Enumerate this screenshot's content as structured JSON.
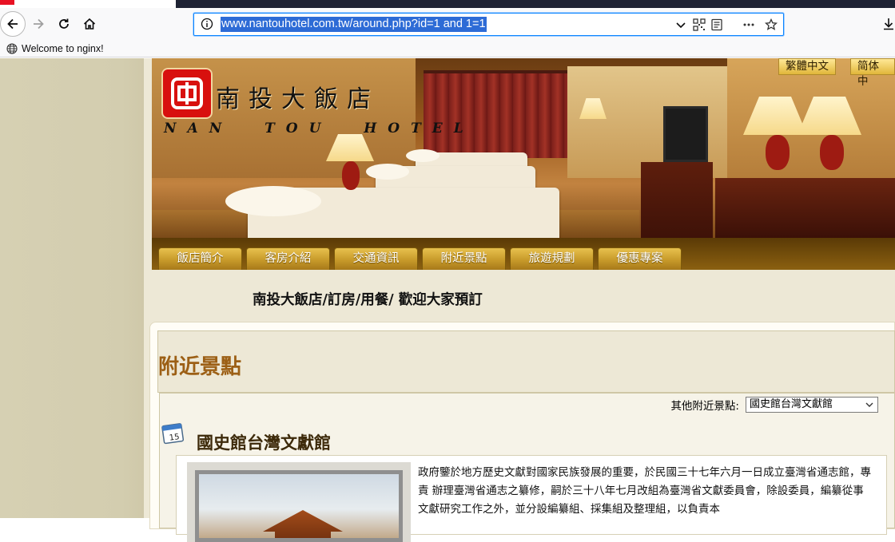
{
  "browser": {
    "url": "www.nantouhotel.com.tw/around.php?id=1 and 1=1",
    "bookmark_label": "Welcome to nginx!"
  },
  "site": {
    "logo_chinese": "南投大飯店",
    "logo_english": "NAN  TOU  HOTEL",
    "lang_traditional": "繁體中文",
    "lang_simplified": "简体中",
    "menu": [
      "飯店簡介",
      "客房介紹",
      "交通資訊",
      "附近景點",
      "旅遊規劃",
      "優惠專案"
    ],
    "slogan": "南投大飯店/訂房/用餐/ 歡迎大家預訂",
    "section_title": "附近景點",
    "filter_label": "其他附近景點:",
    "filter_selected": "國史館台灣文獻館",
    "calendar_day": "15",
    "attraction_title": "國史館台灣文獻館",
    "attraction_desc": "政府鑒於地方歷史文獻對國家民族發展的重要，於民國三十七年六月一日成立臺灣省通志館，專責 辦理臺灣省通志之纂修，嗣於三十八年七月改組為臺灣省文獻委員會，除設委員，編纂從事文獻研究工作之外，並分設編纂組、採集組及整理組，以負責本"
  }
}
